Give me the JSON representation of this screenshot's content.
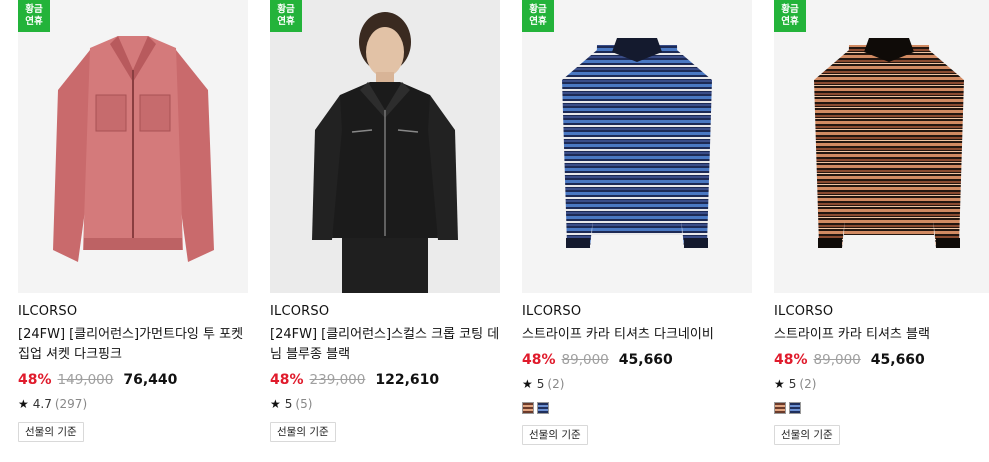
{
  "products": [
    {
      "badge": [
        "황금",
        "연휴"
      ],
      "brand": "ILCORSO",
      "title": "[24FW] [클리어런스]가먼트다잉 투 포켓 집업 셔켓 다크핑크",
      "discount": "48%",
      "original_price": "149,000",
      "price": "76,440",
      "rating": "4.7",
      "review_count": "(297)",
      "gift_label": "선물의 기준",
      "swatches": []
    },
    {
      "badge": [
        "황금",
        "연휴"
      ],
      "brand": "ILCORSO",
      "title": "[24FW] [클리어런스]스컬스 크롭 코팅 데님 블루종 블랙",
      "discount": "48%",
      "original_price": "239,000",
      "price": "122,610",
      "rating": "5",
      "review_count": "(5)",
      "gift_label": "선물의 기준",
      "swatches": []
    },
    {
      "badge": [
        "황금",
        "연휴"
      ],
      "brand": "ILCORSO",
      "title": "스트라이프 카라 티셔츠 다크네이비",
      "discount": "48%",
      "original_price": "89,000",
      "price": "45,660",
      "rating": "5",
      "review_count": "(2)",
      "gift_label": "선물의 기준",
      "swatches": [
        "#6b3a2a",
        "#1f2f5c"
      ]
    },
    {
      "badge": [
        "황금",
        "연휴"
      ],
      "brand": "ILCORSO",
      "title": "스트라이프 카라 티셔츠 블랙",
      "discount": "48%",
      "original_price": "89,000",
      "price": "45,660",
      "rating": "5",
      "review_count": "(2)",
      "gift_label": "선물의 기준",
      "swatches": [
        "#6b3a2a",
        "#1f2f5c"
      ]
    }
  ],
  "colors": {
    "badge": "#23b33a",
    "discount": "#e01b2c"
  }
}
